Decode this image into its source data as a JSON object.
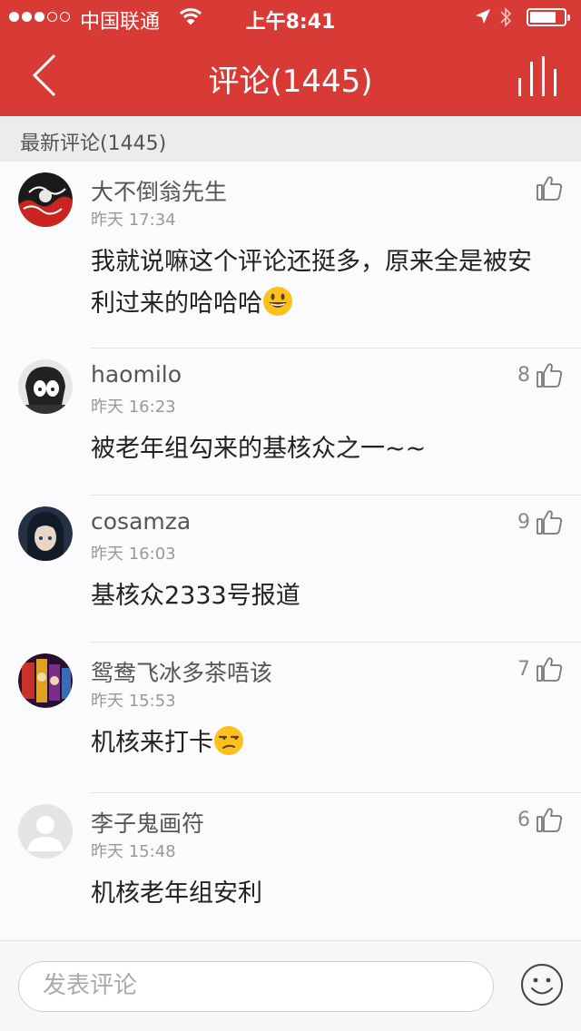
{
  "status_bar": {
    "carrier": "中国联通",
    "time": "上午8:41"
  },
  "nav": {
    "title": "评论(1445)"
  },
  "section": {
    "label": "最新评论(1445)"
  },
  "comments": [
    {
      "user": "大不倒翁先生",
      "time": "昨天 17:34",
      "likes": "",
      "text": "我就说嘛这个评论还挺多，原来全是被安利过来的哈哈哈",
      "emoji": "grinning-face-emoji",
      "avatar": "avatar-red-art"
    },
    {
      "user": "haomilo",
      "time": "昨天 16:23",
      "likes": "8",
      "text": "被老年组勾来的基核众之一~~",
      "emoji": "",
      "avatar": "avatar-bw-anime"
    },
    {
      "user": "cosamza",
      "time": "昨天 16:03",
      "likes": "9",
      "text": "基核众2333号报道",
      "emoji": "",
      "avatar": "avatar-dark-anime"
    },
    {
      "user": "鸳鸯飞冰多茶唔该",
      "time": "昨天 15:53",
      "likes": "7",
      "text": "机核来打卡",
      "emoji": "unamused-face-emoji",
      "avatar": "avatar-colorful"
    },
    {
      "user": "李子鬼画符",
      "time": "昨天 15:48",
      "likes": "6",
      "text": "机核老年组安利",
      "emoji": "",
      "avatar": "avatar-default"
    }
  ],
  "input": {
    "placeholder": "发表评论"
  },
  "colors": {
    "header": "#d83a35",
    "list_bg": "#fbfbfd",
    "section_bg": "#ececec"
  },
  "icons": [
    "back-chevron-icon",
    "bar-chart-icon",
    "thumbs-up-icon",
    "smiley-icon",
    "wifi-icon",
    "location-arrow-icon",
    "bluetooth-icon",
    "battery-icon"
  ]
}
